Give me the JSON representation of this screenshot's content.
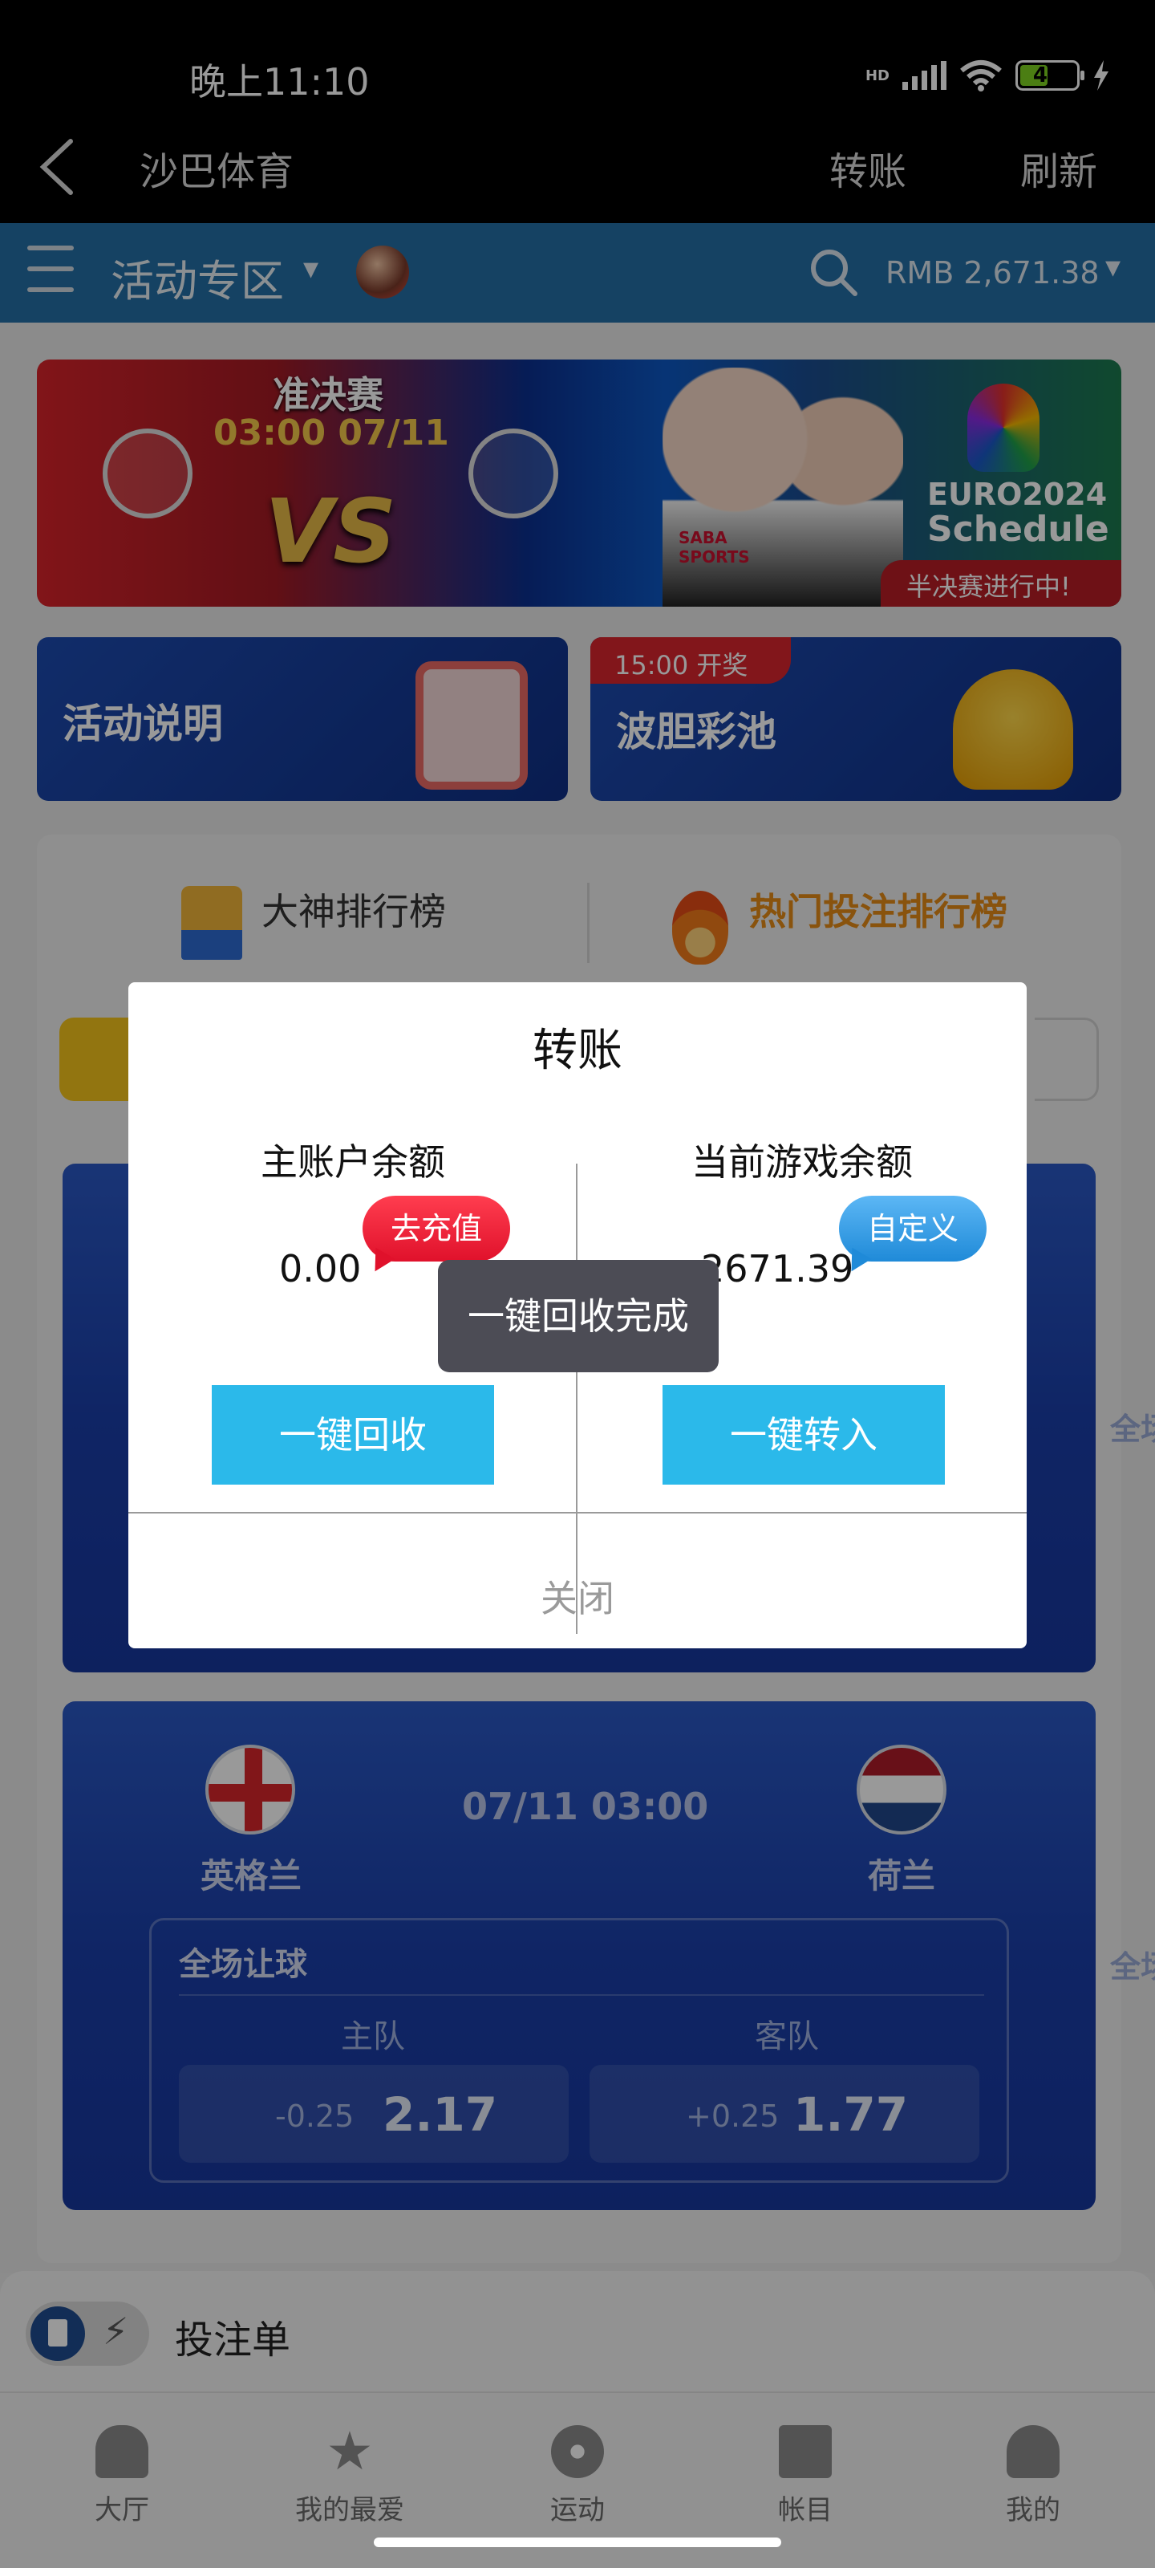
{
  "status_bar": {
    "time": "晚上11:10",
    "battery": "49",
    "net_label": "HD"
  },
  "title_bar": {
    "title": "沙巴体育",
    "action_transfer": "转账",
    "action_refresh": "刷新"
  },
  "app_header": {
    "section": "活动专区",
    "balance": "RMB 2,671.38"
  },
  "hero": {
    "stage": "准决赛",
    "datetime": "03:00 07/11",
    "vs": "VS",
    "euro_line1": "EURO2024",
    "euro_line2": "Schedule",
    "live_badge": "半决赛进行中!",
    "sponsor": "SABA SPORTS"
  },
  "cards": [
    {
      "label": "活动说明",
      "tag": ""
    },
    {
      "label": "波胆彩池",
      "tag": "15:00 开奖"
    }
  ],
  "leaderboards": {
    "tab1": "大神排行榜",
    "tab2": "热门投注排行榜"
  },
  "matches": [
    {
      "home": "英格兰",
      "away": "荷兰",
      "datetime": "07/11 03:00",
      "market": "全场让球",
      "col_home": "主队",
      "col_away": "客队",
      "home_handicap": "-0.25",
      "home_odds": "2.17",
      "away_handicap": "+0.25",
      "away_odds": "1.77"
    }
  ],
  "peek_labels": [
    "全场",
    "全场"
  ],
  "dialog": {
    "title": "转账",
    "main_label": "主账户余额",
    "main_value": "0.00",
    "recharge_bubble": "去充值",
    "game_label": "当前游戏余额",
    "game_value": "2671.39",
    "custom_bubble": "自定义",
    "recall_button": "一键回收",
    "transfer_in_button": "一键转入",
    "close_button": "关闭",
    "toast": "一键回收完成"
  },
  "bet_slip": {
    "label": "投注单"
  },
  "bottom_nav": [
    {
      "label": "大厅",
      "icon": "home-icon"
    },
    {
      "label": "我的最爱",
      "icon": "star-icon"
    },
    {
      "label": "运动",
      "icon": "ball-icon"
    },
    {
      "label": "帐目",
      "icon": "ledger-icon"
    },
    {
      "label": "我的",
      "icon": "user-icon"
    }
  ]
}
